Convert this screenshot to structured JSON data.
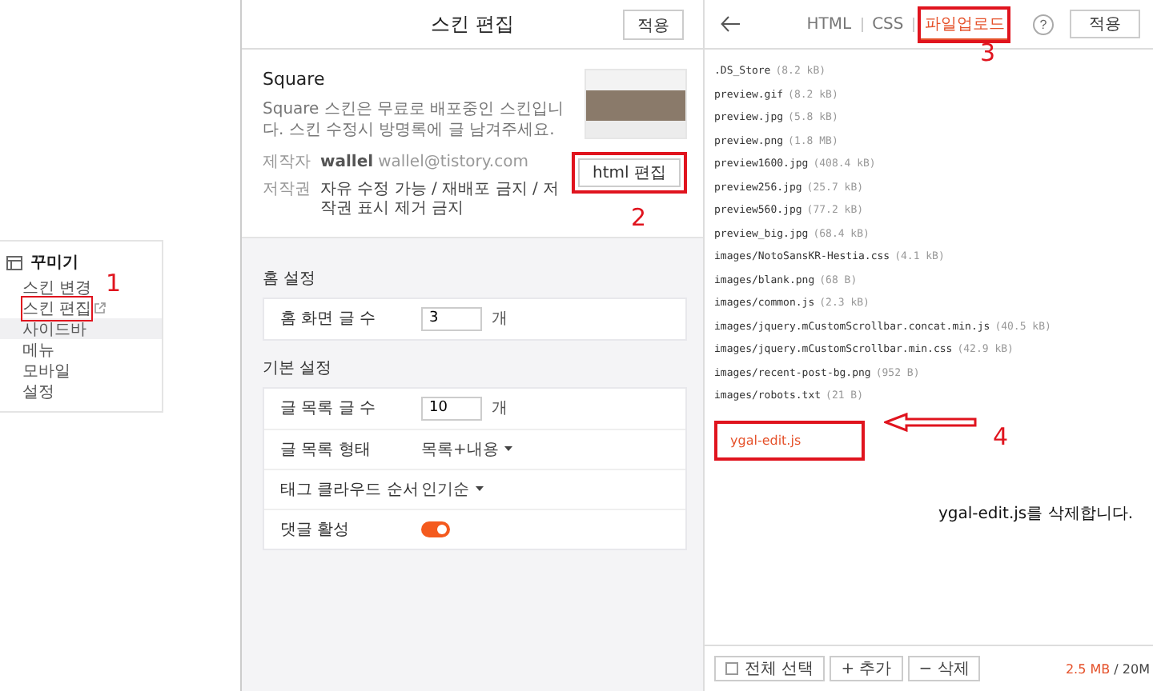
{
  "left_menu": {
    "title": "꾸미기",
    "items": [
      {
        "label": "스킨 변경",
        "selected": false,
        "external": false,
        "highlighted": false
      },
      {
        "label": "스킨 편집",
        "selected": false,
        "external": true,
        "highlighted": true
      },
      {
        "label": "사이드바",
        "selected": true,
        "external": false,
        "highlighted": false
      },
      {
        "label": "메뉴",
        "selected": false,
        "external": false,
        "highlighted": false
      },
      {
        "label": "모바일",
        "selected": false,
        "external": false,
        "highlighted": false
      },
      {
        "label": "설정",
        "selected": false,
        "external": false,
        "highlighted": false
      }
    ]
  },
  "skin_editor": {
    "title": "스킨 편집",
    "apply": "적용",
    "skin": {
      "name": "Square",
      "description": "Square 스킨은 무료로 배포중인 스킨입니다. 스킨 수정시 방명록에 글 남겨주세요.",
      "author_label": "제작자",
      "author": "wallel",
      "email": "wallel@tistory.com",
      "copyright_label": "저작권",
      "copyright": "자유 수정 가능 / 재배포 금지 / 저작권 표시 제거 금지",
      "html_edit": "html 편집",
      "html_edit_highlighted": true
    },
    "sections": [
      {
        "title": "홈 설정",
        "rows": [
          {
            "kind": "number",
            "label": "홈 화면 글 수",
            "value": "3",
            "unit": "개"
          }
        ]
      },
      {
        "title": "기본 설정",
        "rows": [
          {
            "kind": "number",
            "label": "글 목록 글 수",
            "value": "10",
            "unit": "개"
          },
          {
            "kind": "select",
            "label": "글 목록 형태",
            "value": "목록+내용"
          },
          {
            "kind": "select",
            "label": "태그 클라우드 순서",
            "value": "인기순"
          },
          {
            "kind": "toggle",
            "label": "댓글 활성",
            "on": true
          }
        ]
      }
    ]
  },
  "file_editor": {
    "tabs": [
      {
        "label": "HTML",
        "selected": false,
        "highlighted": false
      },
      {
        "label": "CSS",
        "selected": false,
        "highlighted": false
      },
      {
        "label": "파일업로드",
        "selected": true,
        "highlighted": true
      }
    ],
    "help": "?",
    "apply": "적용",
    "files": [
      {
        "name": ".DS_Store",
        "size": "(8.2 kB)"
      },
      {
        "name": "preview.gif",
        "size": "(8.2 kB)"
      },
      {
        "name": "preview.jpg",
        "size": "(5.8 kB)"
      },
      {
        "name": "preview.png",
        "size": "(1.8 MB)"
      },
      {
        "name": "preview1600.jpg",
        "size": "(408.4 kB)"
      },
      {
        "name": "preview256.jpg",
        "size": "(25.7 kB)"
      },
      {
        "name": "preview560.jpg",
        "size": "(77.2 kB)"
      },
      {
        "name": "preview_big.jpg",
        "size": "(68.4 kB)"
      },
      {
        "name": "images/NotoSansKR-Hestia.css",
        "size": "(4.1 kB)"
      },
      {
        "name": "images/blank.png",
        "size": "(68 B)"
      },
      {
        "name": "images/common.js",
        "size": "(2.3 kB)"
      },
      {
        "name": "images/jquery.mCustomScrollbar.concat.min.js",
        "size": "(40.5 kB)"
      },
      {
        "name": "images/jquery.mCustomScrollbar.min.css",
        "size": "(42.9 kB)"
      },
      {
        "name": "images/recent-post-bg.png",
        "size": "(952 B)"
      },
      {
        "name": "images/robots.txt",
        "size": "(21 B)"
      }
    ],
    "new_file": {
      "name": "ygal-edit.js",
      "highlighted": true
    },
    "footer": {
      "select_all": "전체 선택",
      "select_all_checked": false,
      "add": "+ 추가",
      "delete": "− 삭제",
      "usage": "2.5 MB",
      "quota": "/ 20M"
    }
  },
  "annotations": {
    "markers": [
      "1",
      "2",
      "3",
      "4"
    ],
    "note": "ygal-edit.js를 삭제합니다."
  }
}
